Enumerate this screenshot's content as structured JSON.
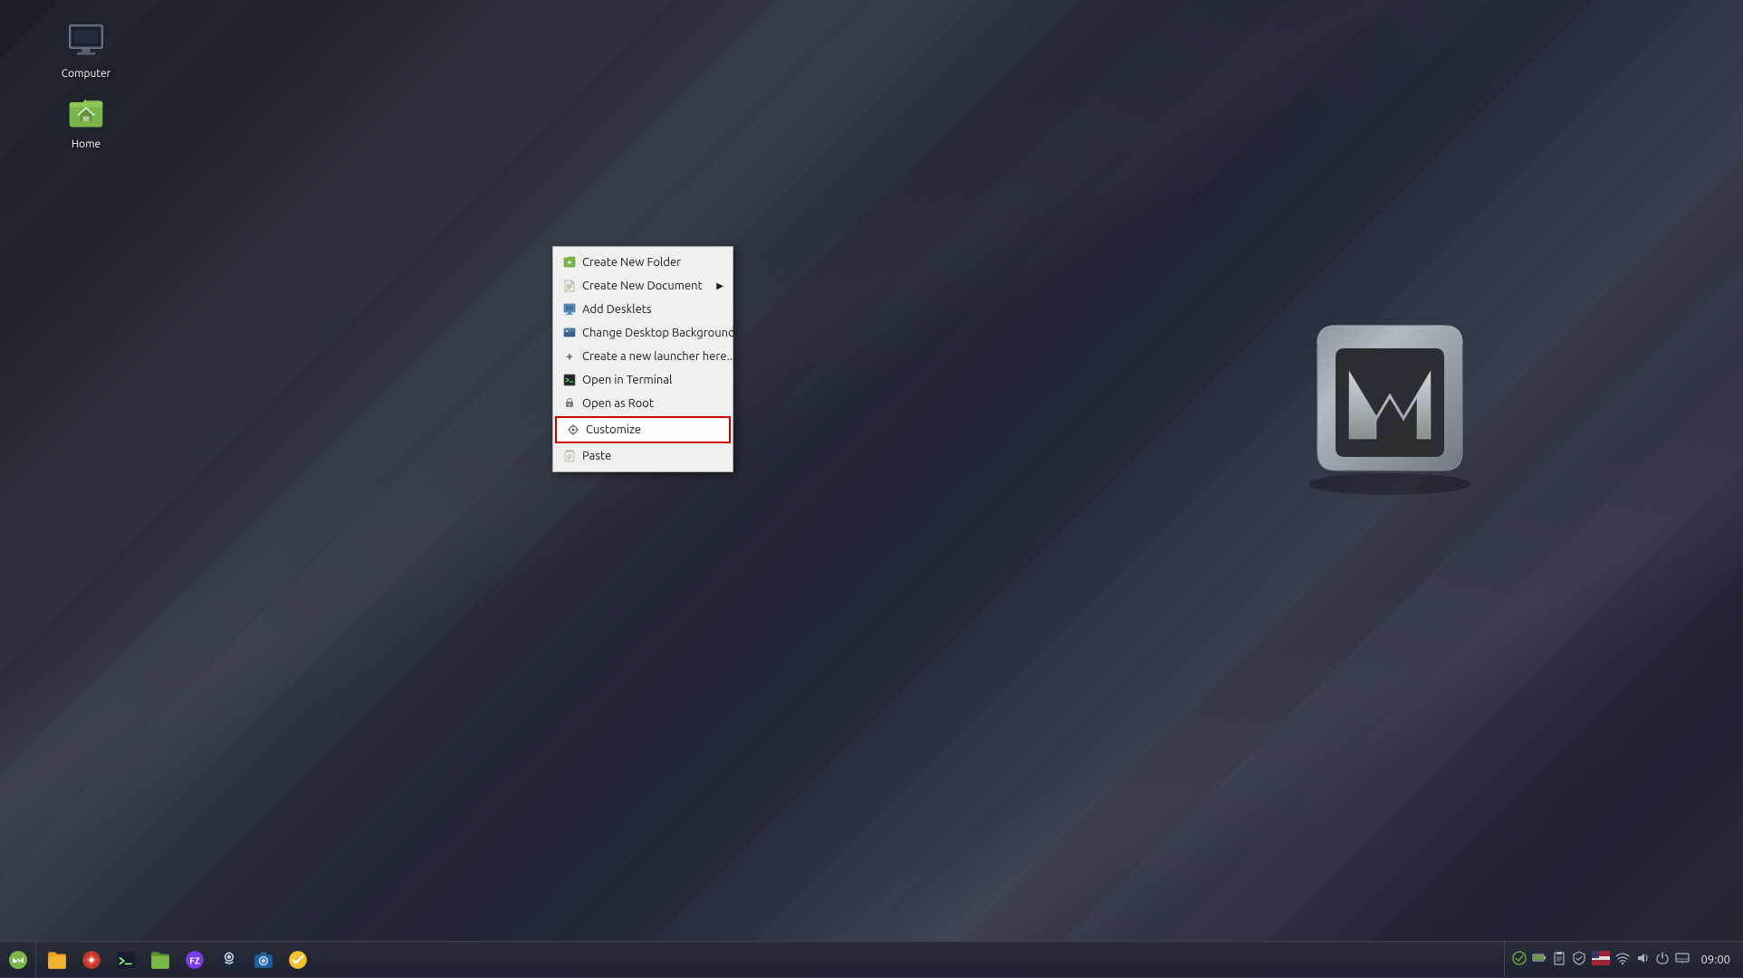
{
  "desktop": {
    "icons": [
      {
        "id": "computer",
        "label": "Computer",
        "type": "computer"
      },
      {
        "id": "home",
        "label": "Home",
        "type": "folder-home"
      }
    ]
  },
  "context_menu": {
    "items": [
      {
        "id": "create-new-folder",
        "label": "Create New Folder",
        "icon": "folder",
        "has_arrow": false,
        "highlighted": false,
        "separator_after": false
      },
      {
        "id": "create-new-document",
        "label": "Create New Document",
        "icon": "document",
        "has_arrow": true,
        "highlighted": false,
        "separator_after": false
      },
      {
        "id": "add-desklets",
        "label": "Add Desklets",
        "icon": "desklet",
        "has_arrow": false,
        "highlighted": false,
        "separator_after": false
      },
      {
        "id": "change-desktop-background",
        "label": "Change Desktop Background",
        "icon": "background",
        "has_arrow": false,
        "highlighted": false,
        "separator_after": false
      },
      {
        "id": "create-launcher",
        "label": "Create a new launcher here...",
        "icon": "plus",
        "has_arrow": false,
        "highlighted": false,
        "separator_after": false
      },
      {
        "id": "open-terminal",
        "label": "Open in Terminal",
        "icon": "terminal",
        "has_arrow": false,
        "highlighted": false,
        "separator_after": false
      },
      {
        "id": "open-as-root",
        "label": "Open as Root",
        "icon": "root",
        "has_arrow": false,
        "highlighted": false,
        "separator_after": false
      },
      {
        "id": "customize",
        "label": "Customize",
        "icon": "customize",
        "has_arrow": false,
        "highlighted": true,
        "separator_after": false
      },
      {
        "id": "paste",
        "label": "Paste",
        "icon": "paste",
        "has_arrow": false,
        "highlighted": false,
        "separator_after": false
      }
    ]
  },
  "taskbar": {
    "start_icon": "mint",
    "clock": "09:00",
    "apps": [
      {
        "id": "files",
        "icon": "folder"
      },
      {
        "id": "chromium",
        "icon": "browser-red"
      },
      {
        "id": "terminal",
        "icon": "terminal"
      },
      {
        "id": "filemanager2",
        "icon": "folder-green"
      },
      {
        "id": "filezilla",
        "icon": "filezilla"
      },
      {
        "id": "steam",
        "icon": "steam"
      },
      {
        "id": "webcam",
        "icon": "camera"
      },
      {
        "id": "ticktick",
        "icon": "ticktick"
      }
    ],
    "tray_icons": [
      "check",
      "battery",
      "clipboard",
      "shield",
      "flag",
      "wifi",
      "volume",
      "lock",
      "network"
    ]
  }
}
